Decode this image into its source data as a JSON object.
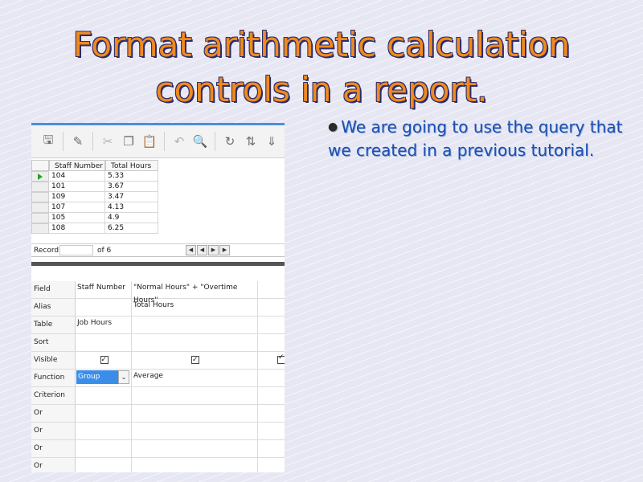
{
  "slide": {
    "title_line1": "Format arithmetic calculation",
    "title_line2": "controls in a report.",
    "bullet": "We are going to use the query that we created in a previous tutorial."
  },
  "toolbar": {
    "icons": [
      "save-icon",
      "edit-icon",
      "cut-icon",
      "copy-icon",
      "paste-icon",
      "undo-icon",
      "find-icon",
      "refresh-icon",
      "sort-icon",
      "filter-icon"
    ]
  },
  "datagrid": {
    "headers": [
      "Staff Number",
      "Total Hours"
    ],
    "rows": [
      [
        "104",
        "5.33"
      ],
      [
        "101",
        "3.67"
      ],
      [
        "109",
        "3.47"
      ],
      [
        "107",
        "4.13"
      ],
      [
        "105",
        "4.9"
      ],
      [
        "108",
        "6.25"
      ]
    ],
    "record_label": "Record",
    "of_label": "of 6"
  },
  "query_design": {
    "rows": [
      {
        "label": "Field",
        "c1": "Staff Number",
        "c2": "\"Normal Hours\" + \"Overtime Hours\""
      },
      {
        "label": "Alias",
        "c1": "",
        "c2": "Total Hours"
      },
      {
        "label": "Table",
        "c1": "Job Hours",
        "c2": ""
      },
      {
        "label": "Sort",
        "c1": "",
        "c2": ""
      },
      {
        "label": "Visible",
        "c1": "",
        "c2": ""
      },
      {
        "label": "Function",
        "c1": "Group",
        "c2": "Average"
      },
      {
        "label": "Criterion",
        "c1": "",
        "c2": ""
      },
      {
        "label": "Or",
        "c1": "",
        "c2": ""
      },
      {
        "label": "Or",
        "c1": "",
        "c2": ""
      },
      {
        "label": "Or",
        "c1": "",
        "c2": ""
      },
      {
        "label": "Or",
        "c1": "",
        "c2": ""
      }
    ]
  },
  "colors": {
    "title": "#f08a1e",
    "bullet": "#1a4fb3",
    "selection": "#3b8ee8"
  }
}
